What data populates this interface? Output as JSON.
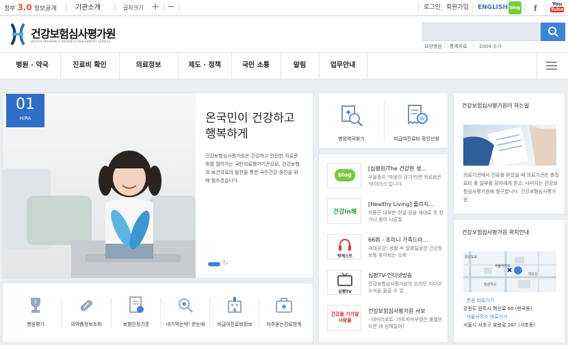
{
  "topbar": {
    "gov_text_1": "정부",
    "gov_version": "3.0",
    "gov_text_2": "정보공개",
    "intro": "기관소개",
    "font_size": "글자크기",
    "plus": "+",
    "minus": "−",
    "login": "로그인",
    "join": "회원가입",
    "english": "ENGLISH",
    "blog": "blog",
    "facebook": "f",
    "youtube_1": "You",
    "youtube_2": "Tube"
  },
  "header": {
    "logo_title": "건강보험심사평가원",
    "logo_sub": "HEALTH INSURANCE REVIEW & ASSESSMENT SERVICE",
    "search_placeholder": "",
    "keywords": [
      "요양병원",
      "통계자료",
      "2004 수가"
    ]
  },
  "nav": {
    "items": [
      "병원 · 약국",
      "진료비 확인",
      "의료정보",
      "제도 · 정책",
      "국민 소통",
      "알림",
      "업무안내"
    ]
  },
  "hero": {
    "badge_num": "01",
    "badge_tag": "HIRA",
    "title": "온국민이 건강하고 행복하게",
    "desc": "건강보험심사평가원은 건강하고 안전한 의료문화를 열어가는 국민의료평가기관으로, 건강보험과 보건의료의 발전을 통한 국민건강 증진을 위해 힘쓰겠습니다."
  },
  "quick": {
    "items": [
      "병원평가",
      "의약품정보조회",
      "보험인정기준",
      "내가먹는약! 한눈에",
      "비급여진료비정보",
      "자주묻는진료항목"
    ]
  },
  "finder": {
    "items": [
      "병원약국찾기",
      "비급여진료비 확인신청"
    ]
  },
  "news": {
    "items": [
      {
        "title": "[심평원/The 건강한 생…",
        "desc": "우울증이 '마음의 감기'라면 외로움은 '바이러스'입니다.",
        "thumb": "blog"
      },
      {
        "title": "[Healthy Living] 줄리지…",
        "desc": "하품은 대부분 전날 잠을 제대로 못 잤거나 몸이 나른할",
        "thumb": "건강in해"
      },
      {
        "title": "66회 - 초미니 가족드라…",
        "desc": "세대공감! 생활 속 알쏭달쏭한 건강정보를 찾아보는 오케",
        "thumb": "팟캐스트"
      },
      {
        "title": "심평TV-인터넷방송",
        "desc": "건강보험심사평가원의 온라인 미디어 소식을 들을 수 있",
        "thumb": "심평TV"
      },
      {
        "title": "건강보험심사평가원 서보",
        "desc": "- 테마리포트- 아토피피부염은 불철만 되면 왜 심해질까?",
        "thumb": "건강을 기가알 사람들"
      }
    ]
  },
  "about": {
    "title": "건강보험심사평가원이 하는일",
    "desc": "의료기관에서 진료를 받았을 때 의료기관은 총진료비 중 일부를 환자에게 받고, 나머지는 건강보험심사평가원에 청구합니다. 건강보험심사평가원"
  },
  "location": {
    "title": "건강보험심사평가원 위치안내",
    "map_labels": [
      "서울사무소",
      "대모산",
      "청원여고",
      "중앙도로"
    ],
    "hq_head": "· 본원 바로가기",
    "hq_addr": "강원도 원주시 혁신로 60 (반곡동)",
    "seoul_head": "· 서울사무소 바로가기",
    "seoul_addr": "서울시 서초구 효령로 267 (서초동)"
  },
  "colors": {
    "accent": "#3d84d8",
    "hero_badge": "#2f6ec7",
    "blog_green": "#7ac943",
    "facebook": "#3b5998",
    "youtube": "#e62117"
  }
}
